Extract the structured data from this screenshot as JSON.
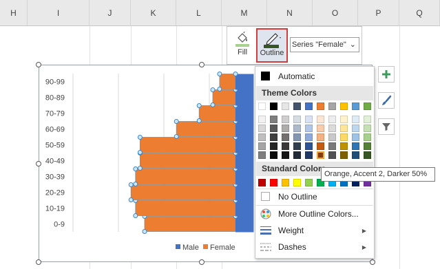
{
  "column_headers": [
    "H",
    "I",
    "J",
    "K",
    "L",
    "M",
    "N",
    "O",
    "P",
    "Q"
  ],
  "toolbar": {
    "fill_label": "Fill",
    "outline_label": "Outline",
    "series_selector": "Series \"Female\""
  },
  "menu": {
    "automatic": "Automatic",
    "theme_colors_heading": "Theme Colors",
    "standard_colors_heading": "Standard Colors",
    "no_outline": "No Outline",
    "more_colors": "More Outline Colors...",
    "weight": "Weight",
    "dashes": "Dashes",
    "theme_top_row": [
      "#ffffff",
      "#000000",
      "#e7e6e6",
      "#44546a",
      "#4472c4",
      "#ed7d31",
      "#a5a5a5",
      "#ffc000",
      "#5b9bd5",
      "#70ad47"
    ],
    "theme_shades": [
      [
        "#f2f2f2",
        "#7f7f7f",
        "#d0cece",
        "#d6dce4",
        "#d9e2f3",
        "#fbe5d5",
        "#ededed",
        "#fff2cc",
        "#deebf6",
        "#e2efd9"
      ],
      [
        "#d8d8d8",
        "#595959",
        "#aeabab",
        "#adb9ca",
        "#b4c6e7",
        "#f7cbac",
        "#dbdbdb",
        "#fee599",
        "#bdd7ee",
        "#c5e0b3"
      ],
      [
        "#bfbfbf",
        "#3f3f3f",
        "#757070",
        "#8496b0",
        "#8eaadb",
        "#f4b183",
        "#c9c9c9",
        "#ffd966",
        "#9dc3e6",
        "#a8d08d"
      ],
      [
        "#a5a5a5",
        "#262626",
        "#3a3838",
        "#323f4f",
        "#2f5496",
        "#c55a11",
        "#7b7b7b",
        "#bf9000",
        "#2e75b5",
        "#538135"
      ],
      [
        "#7f7f7f",
        "#0c0c0c",
        "#171616",
        "#222a35",
        "#1f3864",
        "#833c0b",
        "#525252",
        "#7f6000",
        "#1e4e79",
        "#375623"
      ]
    ],
    "standard_colors": [
      "#c00000",
      "#ff0000",
      "#ffc000",
      "#ffff00",
      "#92d050",
      "#00b050",
      "#00b0f0",
      "#0070c0",
      "#002060",
      "#7030a0"
    ]
  },
  "tooltip": "Orange, Accent 2, Darker 50%",
  "chart_data": {
    "type": "bar",
    "orientation": "horizontal",
    "categories": [
      "0-9",
      "10-19",
      "20-29",
      "30-39",
      "40-49",
      "50-59",
      "60-69",
      "70-79",
      "80-89",
      "90-99"
    ],
    "series": [
      {
        "name": "Male",
        "values": [
          0.4,
          0.4,
          0.4,
          0.4,
          0.4,
          0.4,
          0.4,
          0.4,
          0.4,
          0.4
        ],
        "color": "#4472c4"
      },
      {
        "name": "Female",
        "values": [
          2.0,
          2.2,
          2.3,
          2.2,
          2.1,
          2.1,
          1.3,
          0.8,
          0.5,
          0.35
        ],
        "color": "#ed7d31"
      }
    ],
    "legend_position": "bottom",
    "gridlines": true
  }
}
